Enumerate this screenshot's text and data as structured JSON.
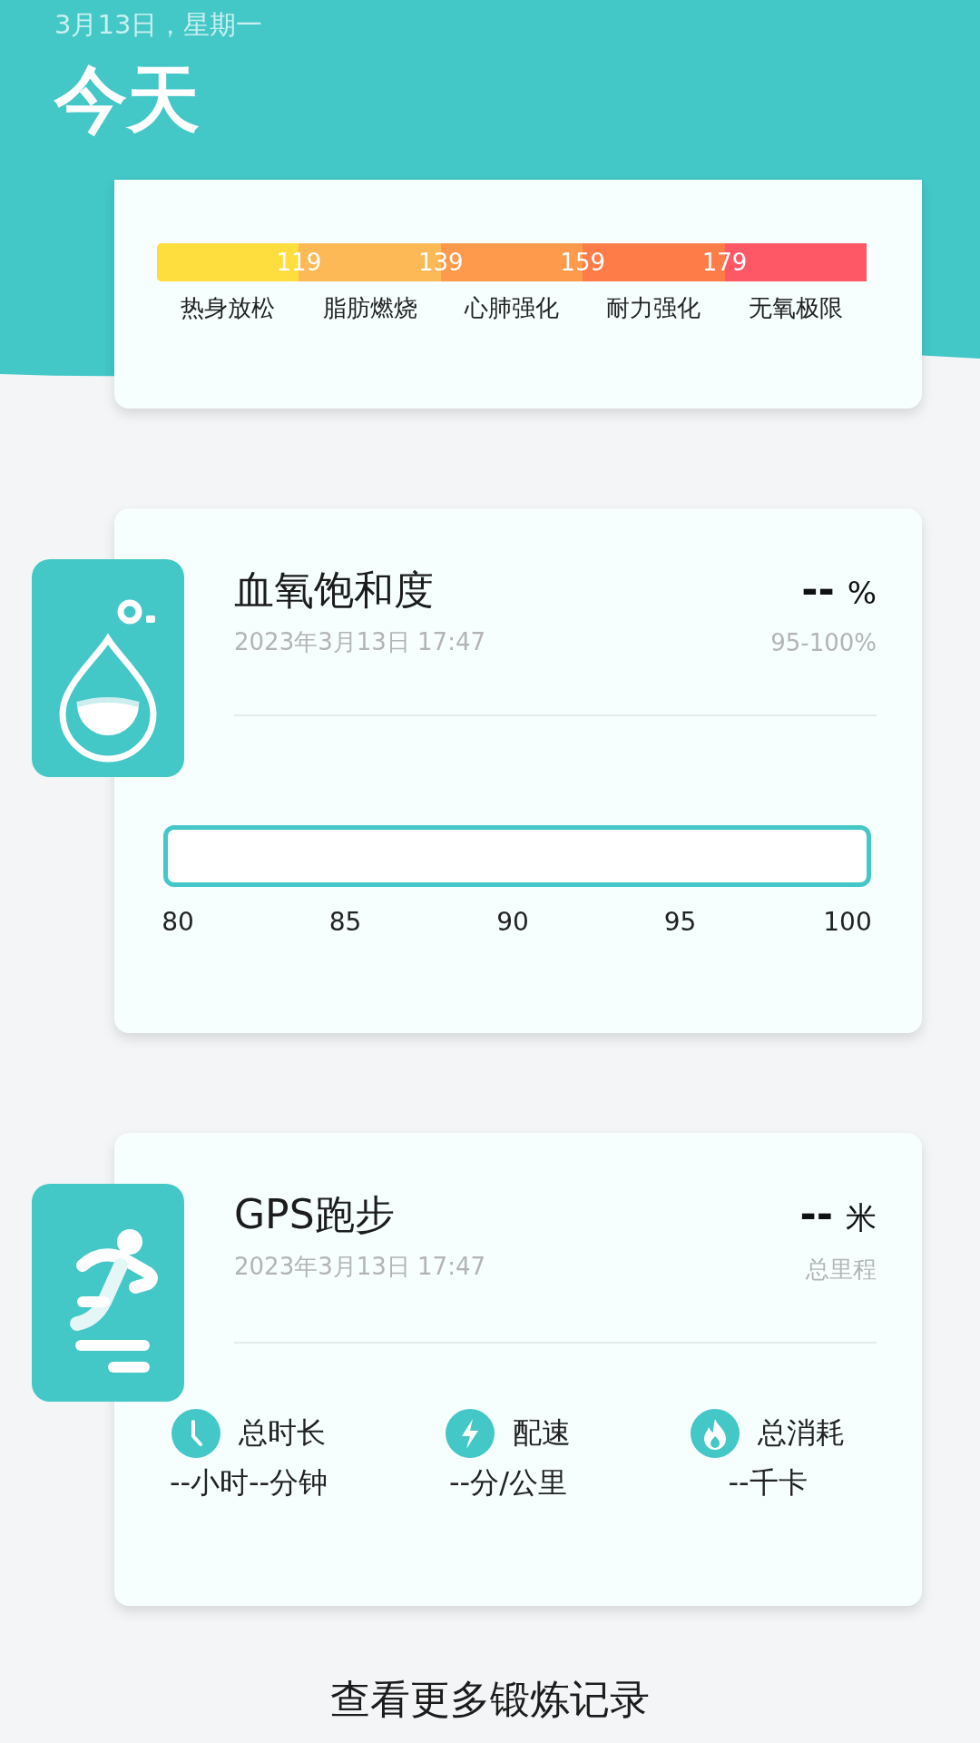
{
  "header": {
    "date": "3月13日，星期一",
    "title": "今天"
  },
  "heart_rate_zones": {
    "thresholds": [
      "119",
      "139",
      "159",
      "179"
    ],
    "zones": [
      {
        "label": "热身放松",
        "color": "#fedd3e"
      },
      {
        "label": "脂肪燃烧",
        "color": "#fdb956"
      },
      {
        "label": "心肺强化",
        "color": "#fd9a4b"
      },
      {
        "label": "耐力强化",
        "color": "#fe7c48"
      },
      {
        "label": "无氧极限",
        "color": "#fe5866"
      }
    ]
  },
  "cards": [
    {
      "kind": "oxygen",
      "title": "血氧饱和度",
      "timestamp": "2023年3月13日 17:47",
      "value": "--",
      "unit": "%",
      "caption": "95-100%",
      "scale": [
        "80",
        "85",
        "90",
        "95",
        "100"
      ]
    },
    {
      "kind": "running",
      "title": "GPS跑步",
      "timestamp": "2023年3月13日 17:47",
      "value": "--",
      "unit": "米",
      "caption": "总里程",
      "stats": [
        {
          "kind": "duration",
          "label": "总时长",
          "value": "--小时--分钟"
        },
        {
          "kind": "pace",
          "label": "配速",
          "value": "--分/公里"
        },
        {
          "kind": "calories",
          "label": "总消耗",
          "value": "--千卡"
        }
      ]
    }
  ],
  "footer_link": "查看更多锻炼记录"
}
